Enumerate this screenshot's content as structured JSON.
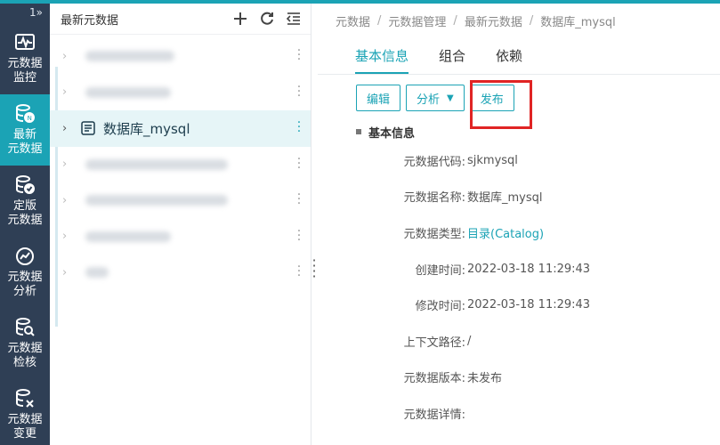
{
  "rail": {
    "toggle": "1»",
    "items": [
      {
        "label_1": "元数据",
        "label_2": "监控",
        "icon": "monitor-wave-icon"
      },
      {
        "label_1": "最新",
        "label_2": "元数据",
        "icon": "database-new-icon"
      },
      {
        "label_1": "定版",
        "label_2": "元数据",
        "icon": "database-check-icon"
      },
      {
        "label_1": "元数据",
        "label_2": "分析",
        "icon": "analysis-chart-icon"
      },
      {
        "label_1": "元数据",
        "label_2": "检核",
        "icon": "database-search-icon"
      },
      {
        "label_1": "元数据",
        "label_2": "变更",
        "icon": "database-change-icon"
      }
    ]
  },
  "tree": {
    "title": "最新元数据",
    "tools": {
      "add": "add-icon",
      "refresh": "refresh-icon",
      "collapse": "collapse-list-icon"
    },
    "selected_label": "数据库_mysql"
  },
  "breadcrumb": [
    "元数据",
    "元数据管理",
    "最新元数据",
    "数据库_mysql"
  ],
  "tabs": [
    "基本信息",
    "组合",
    "依赖"
  ],
  "actions": {
    "edit": "编辑",
    "analyze": "分析",
    "publish": "发布"
  },
  "section_title": "基本信息",
  "fields": [
    {
      "key": "元数据代码:",
      "value": "sjkmysql"
    },
    {
      "key": "元数据名称:",
      "value": "数据库_mysql"
    },
    {
      "key": "元数据类型:",
      "value": "目录(Catalog)"
    },
    {
      "key": "创建时间:",
      "value": "2022-03-18 11:29:43"
    },
    {
      "key": "修改时间:",
      "value": "2022-03-18 11:29:43"
    },
    {
      "key": "上下文路径:",
      "value": "/"
    },
    {
      "key": "元数据版本:",
      "value": "未发布"
    },
    {
      "key": "元数据详情:",
      "value": ""
    }
  ],
  "colors": {
    "accent": "#1ba3b5",
    "rail": "#2f3f55",
    "highlight": "#e02424"
  }
}
